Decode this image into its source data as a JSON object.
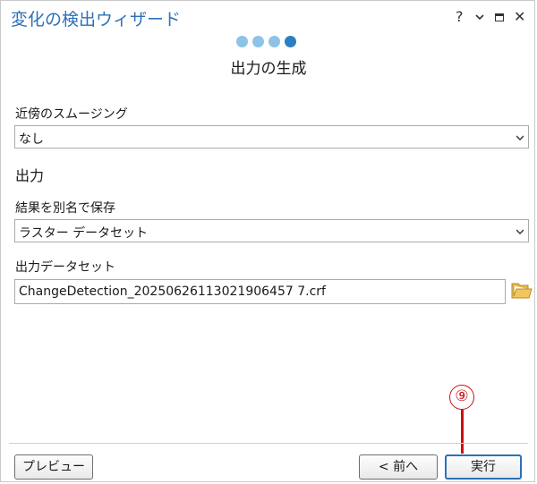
{
  "window": {
    "title": "変化の検出ウィザード",
    "controls": {
      "help": "?",
      "minimize": "⌄",
      "close": "✕"
    }
  },
  "steps": {
    "total": 4,
    "current": 4,
    "title": "出力の生成"
  },
  "smoothing": {
    "label": "近傍のスムージング",
    "value": "なし"
  },
  "output": {
    "section_title": "出力",
    "save_as_label": "結果を別名で保存",
    "save_as_value": "ラスター データセット",
    "dataset_label": "出力データセット",
    "dataset_value": "ChangeDetection_20250626113021906457 7.crf"
  },
  "footer": {
    "preview_label": "プレビュー",
    "back_label": "< 前へ",
    "run_label": "実行"
  },
  "annotation": {
    "marker": "⑨",
    "color": "#cc1010"
  },
  "colors": {
    "accent": "#2b72b8",
    "step_dot": "#8ec2e6",
    "step_dot_active": "#2b7ec4",
    "folder": "#e8b84a"
  }
}
